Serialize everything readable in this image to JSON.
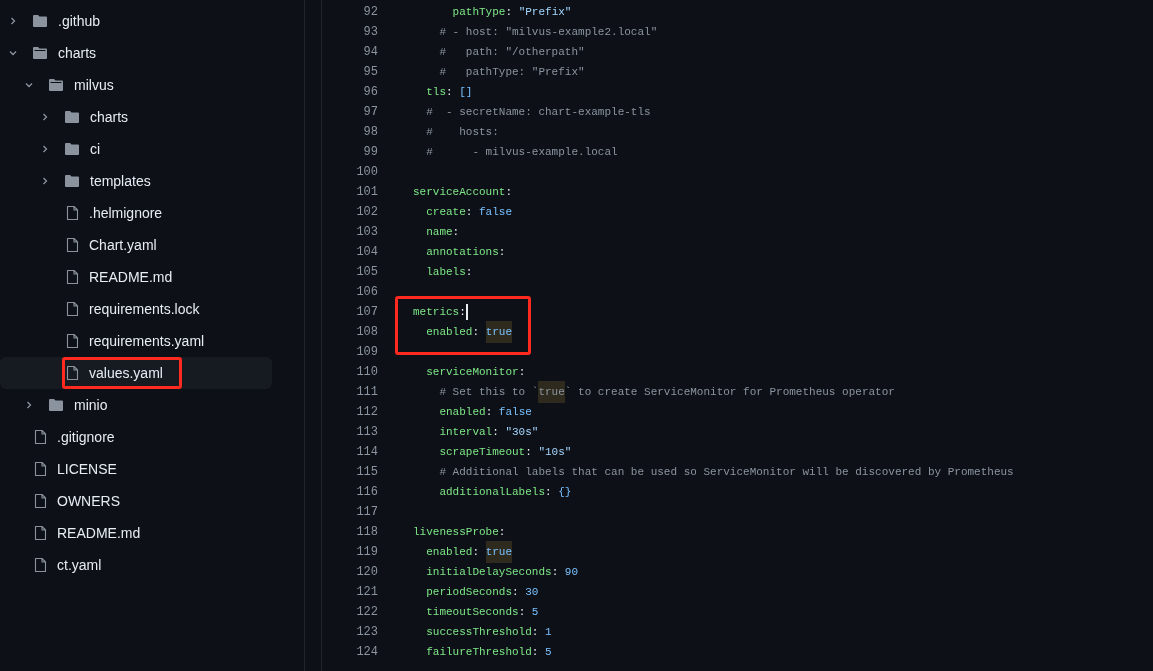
{
  "file_tree": [
    {
      "name": ".github",
      "kind": "folder",
      "expanded": false,
      "selected": false
    },
    {
      "name": "charts",
      "kind": "folder",
      "expanded": true,
      "selected": false,
      "children": [
        {
          "name": "milvus",
          "kind": "folder",
          "expanded": true,
          "selected": false,
          "children": [
            {
              "name": "charts",
              "kind": "folder",
              "expanded": false,
              "selected": false
            },
            {
              "name": "ci",
              "kind": "folder",
              "expanded": false,
              "selected": false
            },
            {
              "name": "templates",
              "kind": "folder",
              "expanded": false,
              "selected": false
            },
            {
              "name": ".helmignore",
              "kind": "file",
              "selected": false
            },
            {
              "name": "Chart.yaml",
              "kind": "file",
              "selected": false
            },
            {
              "name": "README.md",
              "kind": "file",
              "selected": false
            },
            {
              "name": "requirements.lock",
              "kind": "file",
              "selected": false
            },
            {
              "name": "requirements.yaml",
              "kind": "file",
              "selected": false
            },
            {
              "name": "values.yaml",
              "kind": "file",
              "selected": true
            }
          ]
        },
        {
          "name": "minio",
          "kind": "folder",
          "expanded": false,
          "selected": false
        }
      ]
    },
    {
      "name": ".gitignore",
      "kind": "file",
      "selected": false
    },
    {
      "name": "LICENSE",
      "kind": "file",
      "selected": false
    },
    {
      "name": "OWNERS",
      "kind": "file",
      "selected": false
    },
    {
      "name": "README.md",
      "kind": "file",
      "selected": false
    },
    {
      "name": "ct.yaml",
      "kind": "file",
      "selected": false
    }
  ],
  "code_lines": [
    {
      "number": "92",
      "cursor": false,
      "tokens": [
        {
          "kind": "key",
          "text": "      pathType"
        },
        {
          "kind": "punct",
          "text": ": "
        },
        {
          "kind": "string",
          "text": "\"Prefix\""
        }
      ]
    },
    {
      "number": "93",
      "cursor": false,
      "tokens": [
        {
          "kind": "comment",
          "text": "    # - host: \"milvus-example2.local\""
        }
      ]
    },
    {
      "number": "94",
      "cursor": false,
      "tokens": [
        {
          "kind": "comment",
          "text": "    #   path: \"/otherpath\""
        }
      ]
    },
    {
      "number": "95",
      "cursor": false,
      "tokens": [
        {
          "kind": "comment",
          "text": "    #   pathType: \"Prefix\""
        }
      ]
    },
    {
      "number": "96",
      "cursor": false,
      "tokens": [
        {
          "kind": "key",
          "text": "  tls"
        },
        {
          "kind": "punct",
          "text": ": "
        },
        {
          "kind": "value",
          "text": "[]"
        }
      ]
    },
    {
      "number": "97",
      "cursor": false,
      "tokens": [
        {
          "kind": "comment",
          "text": "  #  - secretName: chart-example-tls"
        }
      ]
    },
    {
      "number": "98",
      "cursor": false,
      "tokens": [
        {
          "kind": "comment",
          "text": "  #    hosts:"
        }
      ]
    },
    {
      "number": "99",
      "cursor": false,
      "tokens": [
        {
          "kind": "comment",
          "text": "  #      - milvus-example.local"
        }
      ]
    },
    {
      "number": "100",
      "cursor": false
    },
    {
      "number": "101",
      "cursor": false,
      "tokens": [
        {
          "kind": "key",
          "text": "serviceAccount"
        },
        {
          "kind": "punct",
          "text": ":"
        }
      ]
    },
    {
      "number": "102",
      "cursor": false,
      "tokens": [
        {
          "kind": "key",
          "text": "  create"
        },
        {
          "kind": "punct",
          "text": ": "
        },
        {
          "kind": "value",
          "text": "false"
        }
      ]
    },
    {
      "number": "103",
      "cursor": false,
      "tokens": [
        {
          "kind": "key",
          "text": "  name"
        },
        {
          "kind": "punct",
          "text": ":"
        }
      ]
    },
    {
      "number": "104",
      "cursor": false,
      "tokens": [
        {
          "kind": "key",
          "text": "  annotations"
        },
        {
          "kind": "punct",
          "text": ":"
        }
      ]
    },
    {
      "number": "105",
      "cursor": false,
      "tokens": [
        {
          "kind": "key",
          "text": "  labels"
        },
        {
          "kind": "punct",
          "text": ":"
        }
      ]
    },
    {
      "number": "106",
      "cursor": false
    },
    {
      "number": "107",
      "cursor": true,
      "tokens": [
        {
          "kind": "key",
          "text": "metrics"
        },
        {
          "kind": "punct",
          "text": ":"
        }
      ]
    },
    {
      "number": "108",
      "cursor": false,
      "tokens": [
        {
          "kind": "key",
          "text": "  enabled"
        },
        {
          "kind": "punct",
          "text": ": "
        },
        {
          "kind": "value_match",
          "text": "true"
        }
      ]
    },
    {
      "number": "109",
      "cursor": false
    },
    {
      "number": "110",
      "cursor": false,
      "tokens": [
        {
          "kind": "key",
          "text": "  serviceMonitor"
        },
        {
          "kind": "punct",
          "text": ":"
        }
      ]
    },
    {
      "number": "111",
      "cursor": false,
      "tokens": [
        {
          "kind": "comment",
          "text": "    # Set this to `"
        },
        {
          "kind": "comment_match",
          "text": "true"
        },
        {
          "kind": "comment",
          "text": "` to create ServiceMonitor for Prometheus operator"
        }
      ]
    },
    {
      "number": "112",
      "cursor": false,
      "tokens": [
        {
          "kind": "key",
          "text": "    enabled"
        },
        {
          "kind": "punct",
          "text": ": "
        },
        {
          "kind": "value",
          "text": "false"
        }
      ]
    },
    {
      "number": "113",
      "cursor": false,
      "tokens": [
        {
          "kind": "key",
          "text": "    interval"
        },
        {
          "kind": "punct",
          "text": ": "
        },
        {
          "kind": "string",
          "text": "\"30s\""
        }
      ]
    },
    {
      "number": "114",
      "cursor": false,
      "tokens": [
        {
          "kind": "key",
          "text": "    scrapeTimeout"
        },
        {
          "kind": "punct",
          "text": ": "
        },
        {
          "kind": "string",
          "text": "\"10s\""
        }
      ]
    },
    {
      "number": "115",
      "cursor": false,
      "tokens": [
        {
          "kind": "comment",
          "text": "    # Additional labels that can be used so ServiceMonitor will be discovered by Prometheus"
        }
      ]
    },
    {
      "number": "116",
      "cursor": false,
      "tokens": [
        {
          "kind": "key",
          "text": "    additionalLabels"
        },
        {
          "kind": "punct",
          "text": ": "
        },
        {
          "kind": "value",
          "text": "{}"
        }
      ]
    },
    {
      "number": "117",
      "cursor": false
    },
    {
      "number": "118",
      "cursor": false,
      "tokens": [
        {
          "kind": "key",
          "text": "livenessProbe"
        },
        {
          "kind": "punct",
          "text": ":"
        }
      ]
    },
    {
      "number": "119",
      "cursor": false,
      "tokens": [
        {
          "kind": "key",
          "text": "  enabled"
        },
        {
          "kind": "punct",
          "text": ": "
        },
        {
          "kind": "value_match",
          "text": "true"
        }
      ]
    },
    {
      "number": "120",
      "cursor": false,
      "tokens": [
        {
          "kind": "key",
          "text": "  initialDelaySeconds"
        },
        {
          "kind": "punct",
          "text": ": "
        },
        {
          "kind": "value",
          "text": "90"
        }
      ]
    },
    {
      "number": "121",
      "cursor": false,
      "tokens": [
        {
          "kind": "key",
          "text": "  periodSeconds"
        },
        {
          "kind": "punct",
          "text": ": "
        },
        {
          "kind": "value",
          "text": "30"
        }
      ]
    },
    {
      "number": "122",
      "cursor": false,
      "tokens": [
        {
          "kind": "key",
          "text": "  timeoutSeconds"
        },
        {
          "kind": "punct",
          "text": ": "
        },
        {
          "kind": "value",
          "text": "5"
        }
      ]
    },
    {
      "number": "123",
      "cursor": false,
      "tokens": [
        {
          "kind": "key",
          "text": "  successThreshold"
        },
        {
          "kind": "punct",
          "text": ": "
        },
        {
          "kind": "value",
          "text": "1"
        }
      ]
    },
    {
      "number": "124",
      "cursor": false,
      "tokens": [
        {
          "kind": "key",
          "text": "  failureThreshold"
        },
        {
          "kind": "punct",
          "text": ": "
        },
        {
          "kind": "value",
          "text": "5"
        }
      ]
    }
  ]
}
